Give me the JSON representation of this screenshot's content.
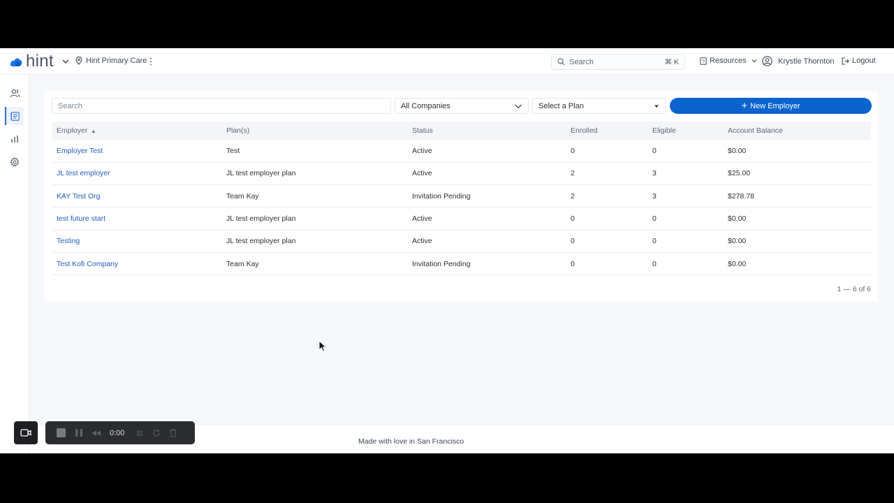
{
  "app": {
    "logo_text": "hint",
    "location": "Hint Primary Care",
    "search_placeholder": "Search",
    "search_shortcut": "⌘ K",
    "resources_label": "Resources",
    "user_name": "Krystle Thornton",
    "logout_label": "Logout",
    "accent_color": "#0b63ce"
  },
  "sidebar": {
    "items": [
      {
        "icon": "people-icon"
      },
      {
        "icon": "employers-icon",
        "active": true
      },
      {
        "icon": "bar-chart-icon"
      },
      {
        "icon": "gear-icon"
      }
    ]
  },
  "filters": {
    "search_placeholder": "Search",
    "companies_value": "All Companies",
    "plan_placeholder": "Select a Plan",
    "new_button_label": "New Employer"
  },
  "table": {
    "headers": [
      "Employer",
      "Plan(s)",
      "Status",
      "Enrolled",
      "Eligible",
      "Account Balance"
    ],
    "rows": [
      {
        "employer": "Employer Test",
        "plan": "Test",
        "status": "Active",
        "enrolled": "0",
        "eligible": "0",
        "balance": "$0.00"
      },
      {
        "employer": "JL test employer",
        "plan": "JL test employer plan",
        "status": "Active",
        "enrolled": "2",
        "eligible": "3",
        "balance": "$25.00"
      },
      {
        "employer": "KAY Test Org",
        "plan": "Team Kay",
        "status": "Invitation Pending",
        "enrolled": "2",
        "eligible": "3",
        "balance": "$278.78"
      },
      {
        "employer": "test future start",
        "plan": "JL test employer plan",
        "status": "Active",
        "enrolled": "0",
        "eligible": "0",
        "balance": "$0.00"
      },
      {
        "employer": "Testing",
        "plan": "JL test employer plan",
        "status": "Active",
        "enrolled": "0",
        "eligible": "0",
        "balance": "$0.00"
      },
      {
        "employer": "Test Kofi Company",
        "plan": "Team Kay",
        "status": "Invitation Pending",
        "enrolled": "0",
        "eligible": "0",
        "balance": "$0.00"
      }
    ],
    "pagination": "1 — 6 of 6"
  },
  "footer": {
    "text": "Made with love in San Francisco"
  },
  "recorder": {
    "time": "0:00"
  }
}
